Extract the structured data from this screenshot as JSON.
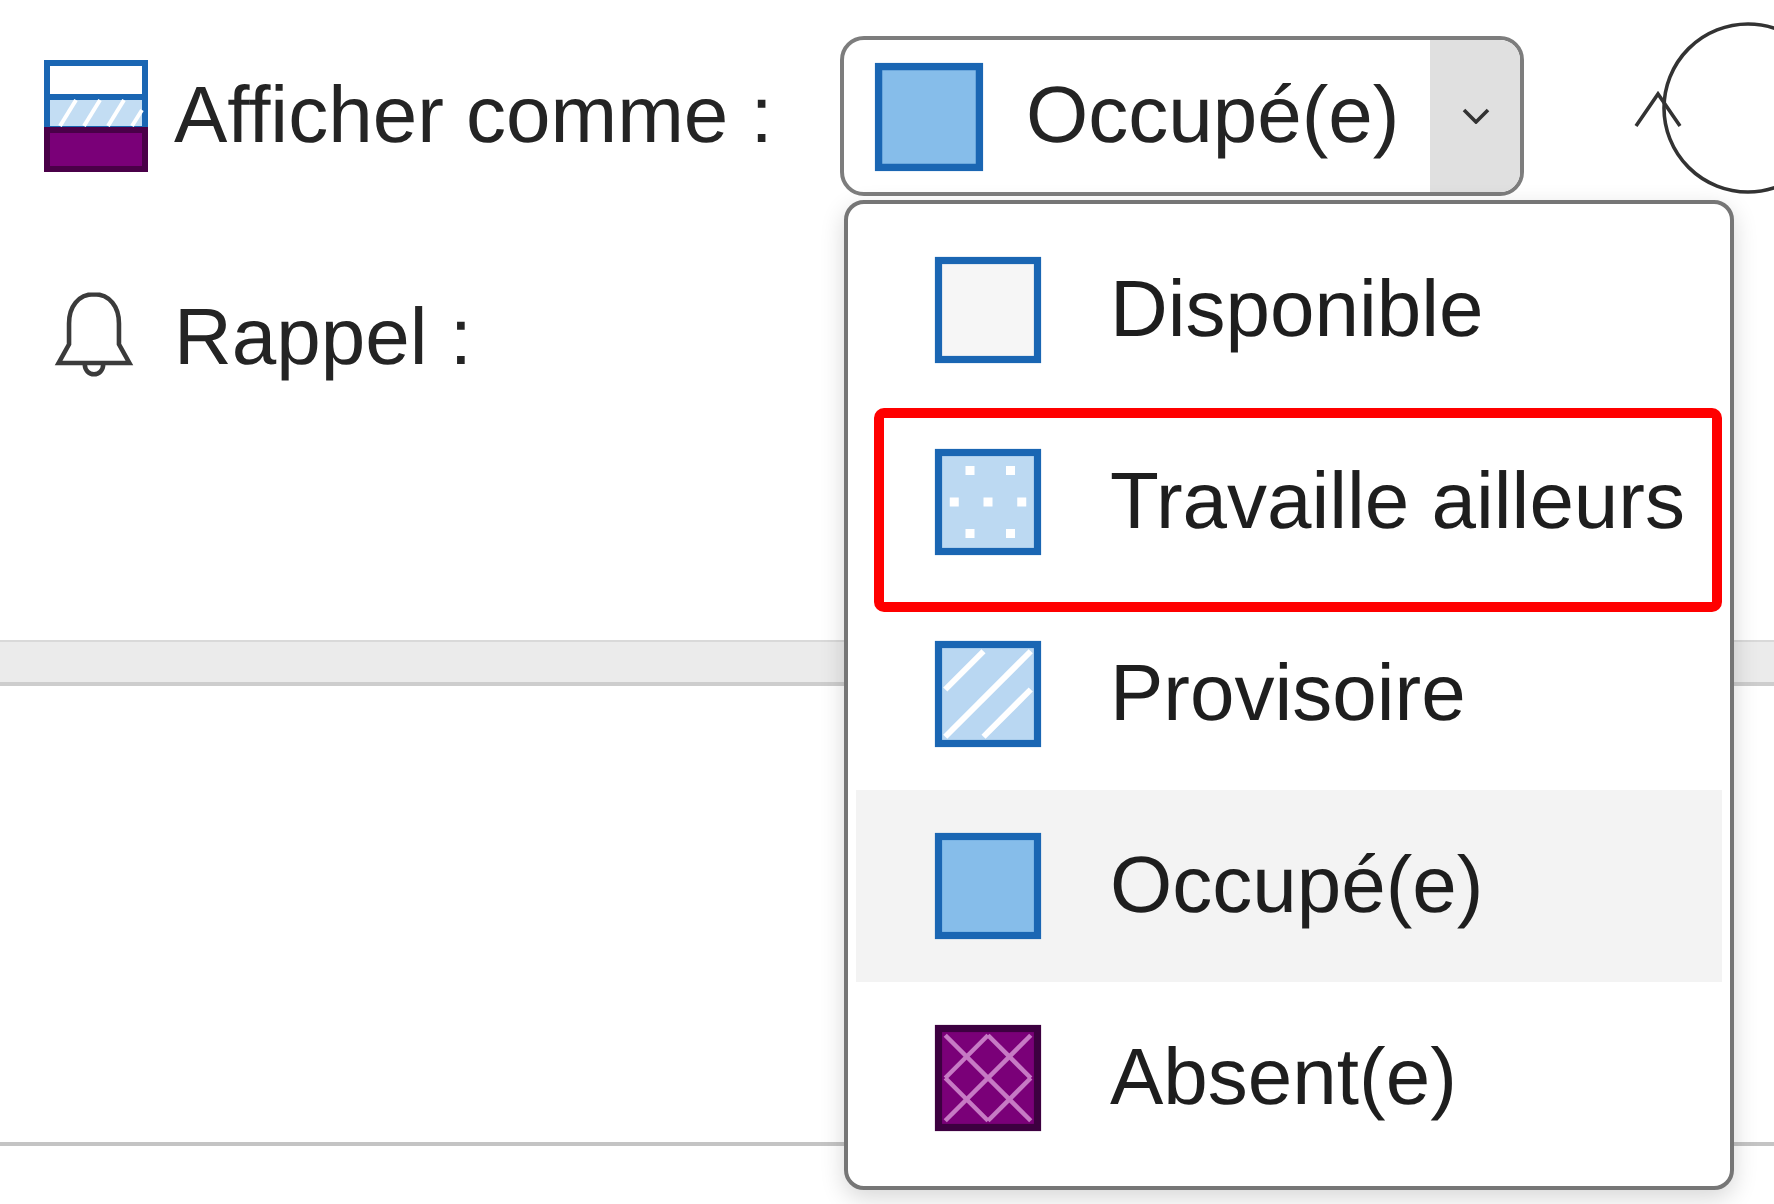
{
  "show_as": {
    "label": "Afficher comme :",
    "selection": {
      "label": "Occupé(e)",
      "kind": "busy"
    },
    "expanded": true
  },
  "reminder": {
    "label": "Rappel :"
  },
  "menu": {
    "items": [
      {
        "label": "Disponible",
        "kind": "free",
        "selected": false,
        "outlined": false
      },
      {
        "label": "Travaille ailleurs",
        "kind": "elsewhere",
        "selected": false,
        "outlined": true
      },
      {
        "label": "Provisoire",
        "kind": "tentative",
        "selected": false,
        "outlined": false
      },
      {
        "label": "Occupé(e)",
        "kind": "busy",
        "selected": true,
        "outlined": false
      },
      {
        "label": "Absent(e)",
        "kind": "away",
        "selected": false,
        "outlined": false
      }
    ]
  }
}
